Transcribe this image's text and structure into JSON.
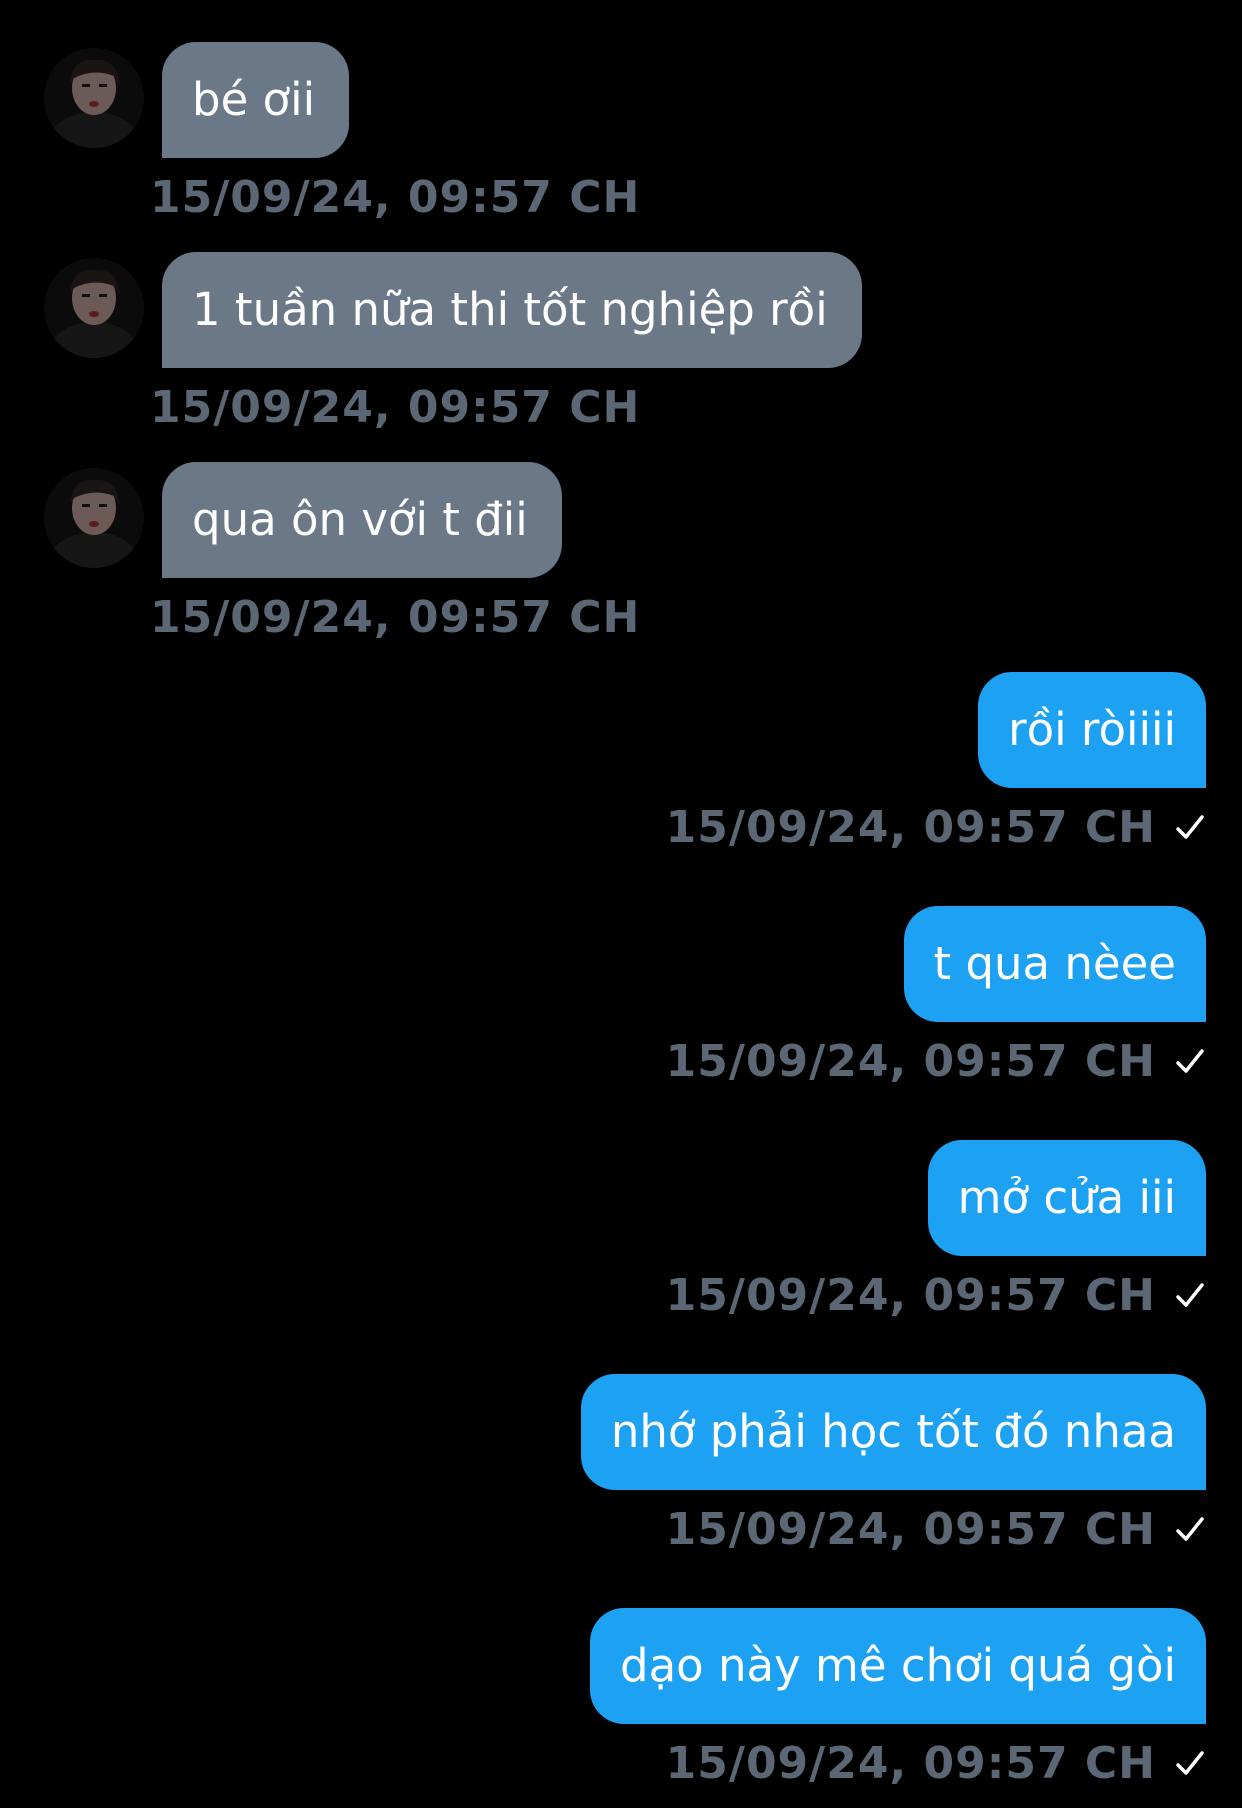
{
  "colors": {
    "background": "#000000",
    "incoming_bubble": "#6a7887",
    "outgoing_bubble": "#1da1f2",
    "timestamp": "#5b6774",
    "bubble_text": "#ffffff"
  },
  "messages": [
    {
      "direction": "incoming",
      "text": "bé ơii",
      "time": "15/09/24, 09:57 CH"
    },
    {
      "direction": "incoming",
      "text": "1 tuần nữa thi tốt nghiệp rồi",
      "time": "15/09/24, 09:57 CH"
    },
    {
      "direction": "incoming",
      "text": "qua ôn với t đii",
      "time": "15/09/24, 09:57 CH"
    },
    {
      "direction": "outgoing",
      "text": "rồi ròiiii",
      "time": "15/09/24, 09:57 CH",
      "status_icon": "check-icon"
    },
    {
      "direction": "outgoing",
      "text": "t qua nèee",
      "time": "15/09/24, 09:57 CH",
      "status_icon": "check-icon"
    },
    {
      "direction": "outgoing",
      "text": "mở cửa iii",
      "time": "15/09/24, 09:57 CH",
      "status_icon": "check-icon"
    },
    {
      "direction": "outgoing",
      "text": "nhớ phải học tốt đó nhaa",
      "time": "15/09/24, 09:57 CH",
      "status_icon": "check-icon"
    },
    {
      "direction": "outgoing",
      "text": "dạo này mê chơi quá gòi",
      "time": "15/09/24, 09:57 CH",
      "status_icon": "check-icon"
    }
  ]
}
